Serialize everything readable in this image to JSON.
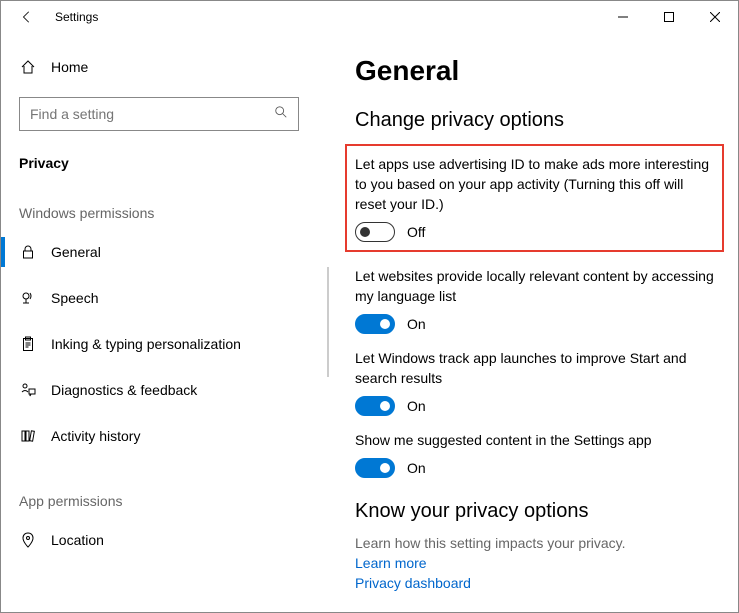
{
  "titlebar": {
    "title": "Settings"
  },
  "sidebar": {
    "home_label": "Home",
    "search_placeholder": "Find a setting",
    "section_title": "Privacy",
    "group1_title": "Windows permissions",
    "items": [
      {
        "label": "General"
      },
      {
        "label": "Speech"
      },
      {
        "label": "Inking & typing personalization"
      },
      {
        "label": "Diagnostics & feedback"
      },
      {
        "label": "Activity history"
      }
    ],
    "group2_title": "App permissions",
    "items2": [
      {
        "label": "Location"
      }
    ]
  },
  "main": {
    "page_title": "General",
    "subhead": "Change privacy options",
    "settings": [
      {
        "desc": "Let apps use advertising ID to make ads more interesting to you based on your app activity (Turning this off will reset your ID.)",
        "state": "Off"
      },
      {
        "desc": "Let websites provide locally relevant content by accessing my language list",
        "state": "On"
      },
      {
        "desc": "Let Windows track app launches to improve Start and search results",
        "state": "On"
      },
      {
        "desc": "Show me suggested content in the Settings app",
        "state": "On"
      }
    ],
    "know_head": "Know your privacy options",
    "know_desc": "Learn how this setting impacts your privacy.",
    "link1": "Learn more",
    "link2": "Privacy dashboard"
  }
}
